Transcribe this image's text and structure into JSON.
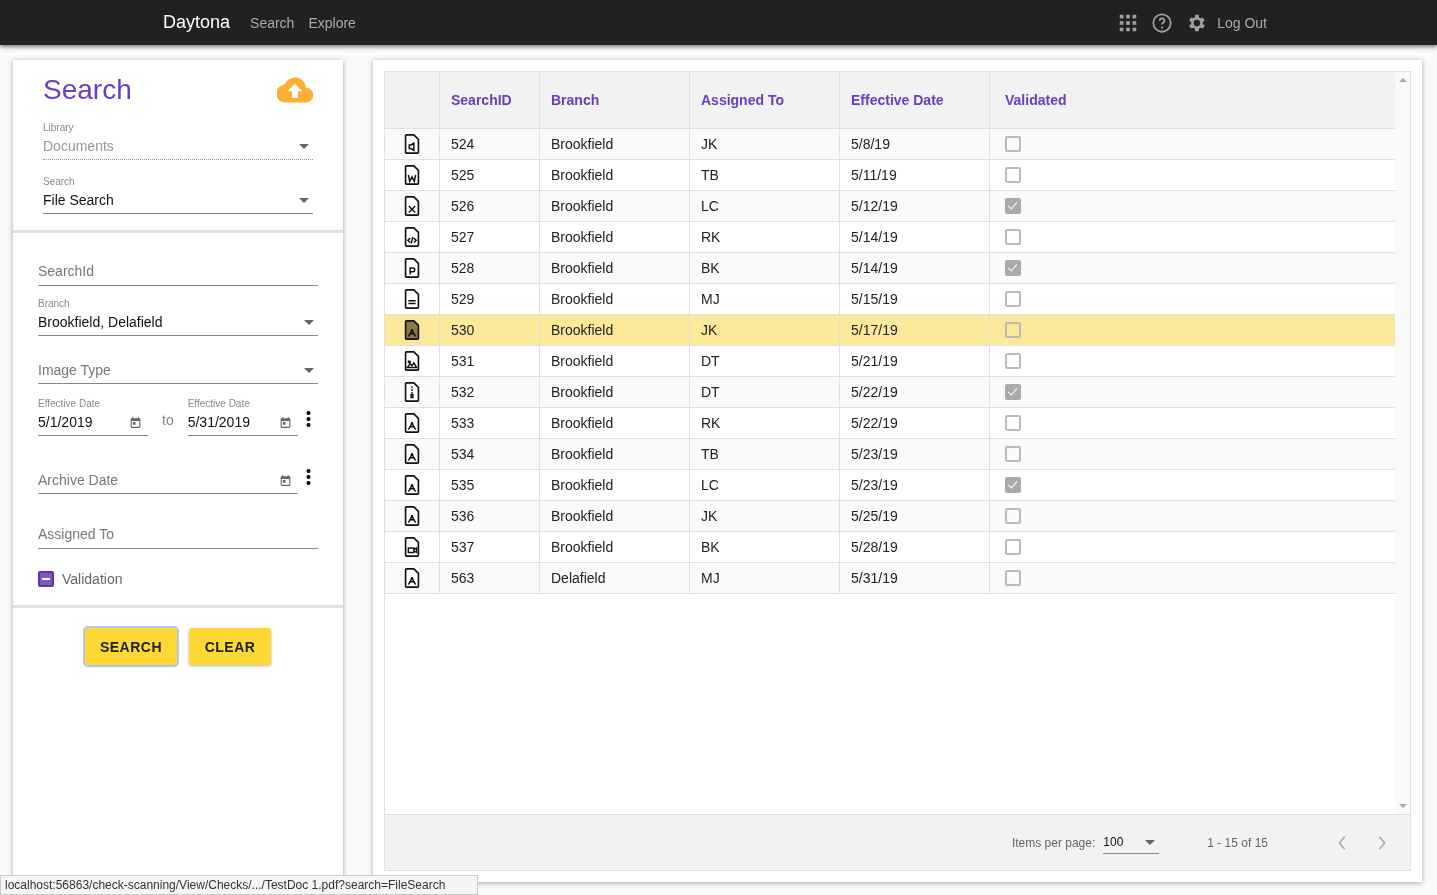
{
  "topbar": {
    "brand": "Daytona",
    "nav": [
      "Search",
      "Explore"
    ],
    "logout": "Log Out"
  },
  "search_panel": {
    "title": "Search",
    "library": {
      "label": "Library",
      "value": "Documents",
      "disabled": true
    },
    "search": {
      "label": "Search",
      "value": "File Search",
      "disabled": false
    },
    "search_id": {
      "placeholder": "SearchId"
    },
    "branch": {
      "label": "Branch",
      "value": "Brookfield, Delafield"
    },
    "image_type": {
      "placeholder": "Image Type"
    },
    "effective_from": {
      "label": "Effective Date",
      "value": "5/1/2019"
    },
    "to": "to",
    "effective_to": {
      "label": "Effective Date",
      "value": "5/31/2019"
    },
    "archive_date": {
      "placeholder": "Archive Date"
    },
    "assigned_to": {
      "placeholder": "Assigned To"
    },
    "validation": {
      "label": "Validation",
      "indeterminate": true
    },
    "buttons": [
      "SEARCH",
      "CLEAR"
    ]
  },
  "table": {
    "columns": [
      "SearchID",
      "Branch",
      "Assigned To",
      "Effective Date",
      "Validated"
    ],
    "rows": [
      {
        "kind": "audio",
        "id": "524",
        "branch": "Brookfield",
        "assigned": "JK",
        "date": "5/8/19",
        "validated": false,
        "selected": false
      },
      {
        "kind": "word",
        "id": "525",
        "branch": "Brookfield",
        "assigned": "TB",
        "date": "5/11/19",
        "validated": false,
        "selected": false
      },
      {
        "kind": "excel",
        "id": "526",
        "branch": "Brookfield",
        "assigned": "LC",
        "date": "5/12/19",
        "validated": true,
        "selected": false
      },
      {
        "kind": "code",
        "id": "527",
        "branch": "Brookfield",
        "assigned": "RK",
        "date": "5/14/19",
        "validated": false,
        "selected": false
      },
      {
        "kind": "powerpoint",
        "id": "528",
        "branch": "Brookfield",
        "assigned": "BK",
        "date": "5/14/19",
        "validated": true,
        "selected": false
      },
      {
        "kind": "text",
        "id": "529",
        "branch": "Brookfield",
        "assigned": "MJ",
        "date": "5/15/19",
        "validated": false,
        "selected": false
      },
      {
        "kind": "pdf",
        "id": "530",
        "branch": "Brookfield",
        "assigned": "JK",
        "date": "5/17/19",
        "validated": false,
        "selected": true
      },
      {
        "kind": "image",
        "id": "531",
        "branch": "Brookfield",
        "assigned": "DT",
        "date": "5/21/19",
        "validated": false,
        "selected": false
      },
      {
        "kind": "archive",
        "id": "532",
        "branch": "Brookfield",
        "assigned": "DT",
        "date": "5/22/19",
        "validated": true,
        "selected": false
      },
      {
        "kind": "pdf",
        "id": "533",
        "branch": "Brookfield",
        "assigned": "RK",
        "date": "5/22/19",
        "validated": false,
        "selected": false
      },
      {
        "kind": "pdf",
        "id": "534",
        "branch": "Brookfield",
        "assigned": "TB",
        "date": "5/23/19",
        "validated": false,
        "selected": false
      },
      {
        "kind": "pdf",
        "id": "535",
        "branch": "Brookfield",
        "assigned": "LC",
        "date": "5/23/19",
        "validated": true,
        "selected": false
      },
      {
        "kind": "pdf",
        "id": "536",
        "branch": "Brookfield",
        "assigned": "JK",
        "date": "5/25/19",
        "validated": false,
        "selected": false
      },
      {
        "kind": "video",
        "id": "537",
        "branch": "Brookfield",
        "assigned": "BK",
        "date": "5/28/19",
        "validated": false,
        "selected": false
      },
      {
        "kind": "pdf",
        "id": "563",
        "branch": "Delafield",
        "assigned": "MJ",
        "date": "5/31/19",
        "validated": false,
        "selected": false
      }
    ]
  },
  "paginator": {
    "label": "Items per page:",
    "page_size": "100",
    "range": "1 - 15 of 15"
  },
  "status_url": "localhost:56863/check-scanning/View/Checks/.../TestDoc 1.pdf?search=FileSearch"
}
